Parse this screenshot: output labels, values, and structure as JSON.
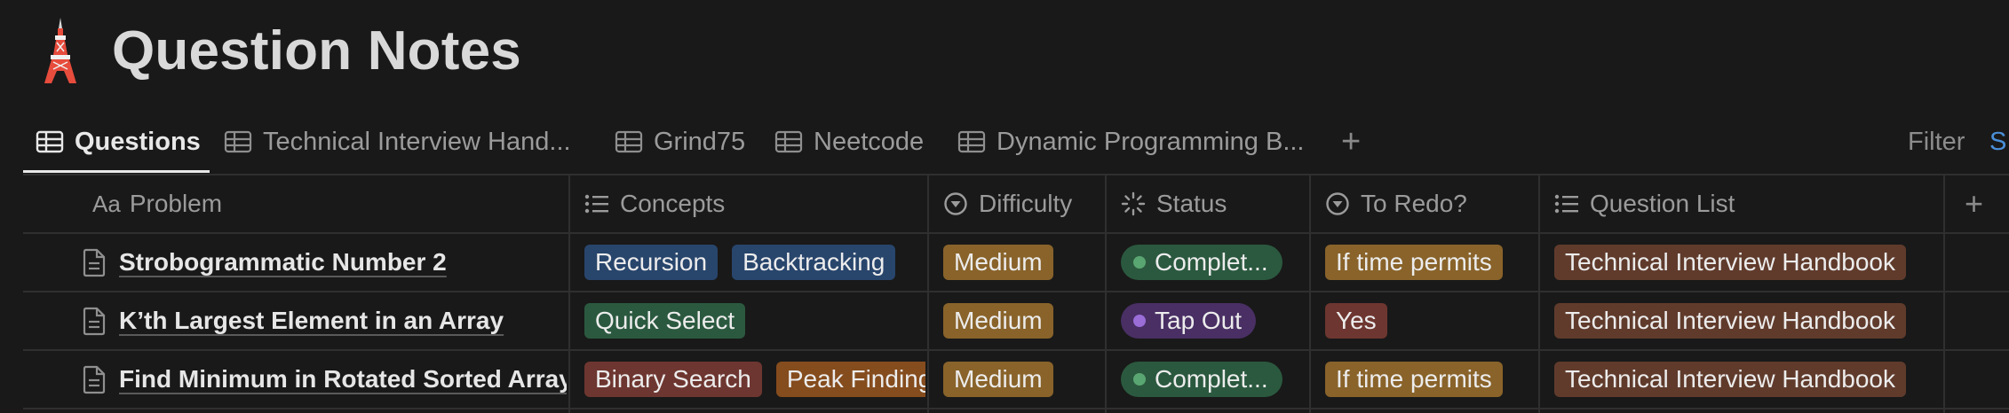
{
  "page": {
    "title": "Question Notes",
    "icon": "tokyo-tower-icon"
  },
  "tabs": [
    {
      "label": "Questions",
      "icon": "table-icon",
      "active": true
    },
    {
      "label": "Technical Interview Hand...",
      "icon": "table-icon",
      "active": false
    },
    {
      "label": "Grind75",
      "icon": "table-icon",
      "active": false
    },
    {
      "label": "Neetcode",
      "icon": "table-icon",
      "active": false
    },
    {
      "label": "Dynamic Programming B...",
      "icon": "table-icon",
      "active": false
    }
  ],
  "toolbar": {
    "add_view": "+",
    "filter_label": "Filter",
    "sort_label": "S"
  },
  "columns": [
    {
      "label": "Problem",
      "icon": "text-property-icon",
      "prefix": "Aa"
    },
    {
      "label": "Concepts",
      "icon": "multi-select-icon"
    },
    {
      "label": "Difficulty",
      "icon": "select-icon"
    },
    {
      "label": "Status",
      "icon": "status-icon"
    },
    {
      "label": "To Redo?",
      "icon": "select-icon"
    },
    {
      "label": "Question List",
      "icon": "multi-select-icon"
    }
  ],
  "add_column": "+",
  "rows": [
    {
      "problem": "Strobogrammatic Number 2",
      "concepts": [
        "Recursion",
        "Backtracking"
      ],
      "difficulty": "Medium",
      "status": "Complet...",
      "to_redo": "If time permits",
      "question_list": "Technical Interview Handbook"
    },
    {
      "problem": "K’th Largest Element in an Array",
      "concepts": [
        "Quick Select"
      ],
      "difficulty": "Medium",
      "status": "Tap Out",
      "to_redo": "Yes",
      "question_list": "Technical Interview Handbook"
    },
    {
      "problem": "Find Minimum in Rotated Sorted Array",
      "concepts": [
        "Binary Search",
        "Peak Finding"
      ],
      "difficulty": "Medium",
      "status": "Complet...",
      "to_redo": "If time permits",
      "question_list": "Technical Interview Handbook"
    }
  ],
  "colors": {
    "background": "#191919",
    "tag_blue": "#28456c",
    "tag_green": "#2b593f",
    "tag_red": "#6e3630",
    "tag_orange": "#854c1d",
    "tag_yellow": "#89632a",
    "tag_brown": "#603b2c",
    "status_complete": "#2b593f",
    "status_tapout": "#492f64",
    "dot_green": "#5aa672",
    "dot_purple": "#9a6dd7",
    "accent_blue": "#4a8fd8"
  }
}
